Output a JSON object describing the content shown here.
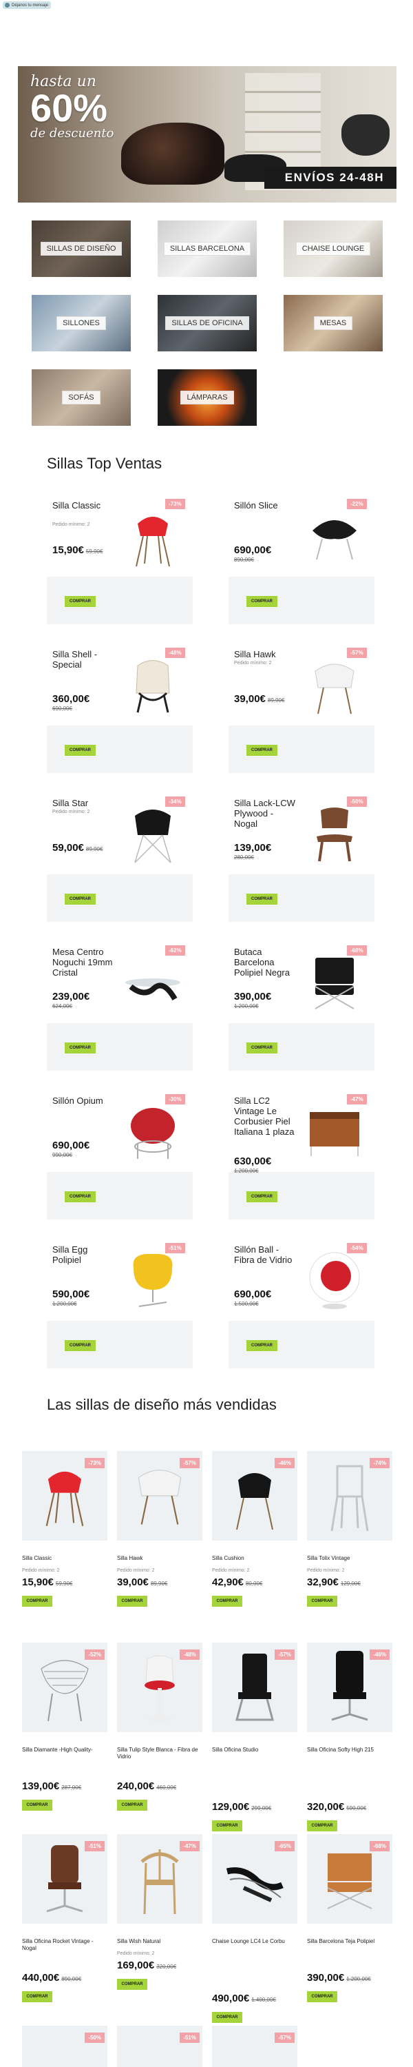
{
  "top_chip": {
    "text": "Déjanos tu mensaje"
  },
  "hero": {
    "line1": "hasta un",
    "line2": "60%",
    "line3": "de descuento",
    "shipping": "ENVÍOS 24-48H"
  },
  "categories": [
    {
      "label": "SILLAS DE DISEÑO"
    },
    {
      "label": "SILLAS BARCELONA"
    },
    {
      "label": "CHAISE LOUNGE"
    },
    {
      "label": "SILLONES"
    },
    {
      "label": "SILLAS DE OFICINA"
    },
    {
      "label": "MESAS"
    },
    {
      "label": "SOFÁS"
    },
    {
      "label": "LÁMPARAS"
    }
  ],
  "top_sales": {
    "title": "Sillas Top Ventas",
    "buy_label": "COMPRAR",
    "items": [
      {
        "name": "Silla Classic",
        "min": "Pedido mínimo: 2",
        "price": "15,90€",
        "old": "59,90€",
        "badge": "-73%"
      },
      {
        "name": "Sillón Slice",
        "min": "",
        "price": "690,00€",
        "old": "890,00€",
        "badge": "-22%"
      },
      {
        "name": "Silla Shell - Special",
        "min": "",
        "price": "360,00€",
        "old": "690,00€",
        "badge": "-48%"
      },
      {
        "name": "Silla Hawk",
        "min": "Pedido mínimo: 2",
        "price": "39,00€",
        "old": "89,90€",
        "badge": "-57%"
      },
      {
        "name": "Silla Star",
        "min": "Pedido mínimo: 2",
        "price": "59,00€",
        "old": "89,90€",
        "badge": "-34%"
      },
      {
        "name": "Silla Lack-LCW Plywood - Nogal",
        "min": "",
        "price": "139,00€",
        "old": "280,00€",
        "badge": "-50%"
      },
      {
        "name": "Mesa Centro Noguchi 19mm Cristal",
        "min": "",
        "price": "239,00€",
        "old": "624,00€",
        "badge": "-62%"
      },
      {
        "name": "Butaca Barcelona Polipiel Negra",
        "min": "",
        "price": "390,00€",
        "old": "1.200,00€",
        "badge": "-68%"
      },
      {
        "name": "Sillón Opium",
        "min": "",
        "price": "690,00€",
        "old": "990,00€",
        "badge": "-30%"
      },
      {
        "name": "Silla LC2 Vintage Le Corbusier Piel Italiana 1 plaza",
        "min": "",
        "price": "630,00€",
        "old": "1.200,00€",
        "badge": "-47%"
      },
      {
        "name": "Silla Egg Polipiel",
        "min": "",
        "price": "590,00€",
        "old": "1.200,00€",
        "badge": "-51%"
      },
      {
        "name": "Sillón Ball - Fibra de Vidrio",
        "min": "",
        "price": "690,00€",
        "old": "1.500,00€",
        "badge": "-54%"
      }
    ]
  },
  "best_sellers": {
    "title": "Las sillas de diseño más vendidas",
    "buy_label": "COMPRAR",
    "items": [
      {
        "name": "Silla Classic",
        "min": "Pedido mínimo: 2",
        "price": "15,90€",
        "old": "59,90€",
        "badge": "-73%"
      },
      {
        "name": "Silla Hawk",
        "min": "Pedido mínimo: 2",
        "price": "39,00€",
        "old": "89,90€",
        "badge": "-57%"
      },
      {
        "name": "Silla Cushion",
        "min": "Pedido mínimo: 2",
        "price": "42,90€",
        "old": "80,00€",
        "badge": "-46%"
      },
      {
        "name": "Silla Tolix Vintage",
        "min": "Pedido mínimo: 2",
        "price": "32,90€",
        "old": "129,00€",
        "badge": "-74%"
      },
      {
        "name": "Silla Diamante -High Quality-",
        "min": "",
        "price": "139,00€",
        "old": "287,00€",
        "badge": "-52%"
      },
      {
        "name": "Silla Tulip Style Blanca - Fibra de Vidrio",
        "min": "",
        "price": "240,00€",
        "old": "460,00€",
        "badge": "-48%"
      },
      {
        "name": "Silla Oficina Studio",
        "min": "",
        "price": "129,00€",
        "old": "299,00€",
        "badge": "-57%"
      },
      {
        "name": "Silla Oficina Softy High 215",
        "min": "",
        "price": "320,00€",
        "old": "590,00€",
        "badge": "-46%"
      },
      {
        "name": "Silla Oficina Rocket Vintage - Nogal",
        "min": "",
        "price": "440,00€",
        "old": "890,00€",
        "badge": "-51%"
      },
      {
        "name": "Silla Wish Natural",
        "min": "Pedido mínimo: 2",
        "price": "169,00€",
        "old": "320,00€",
        "badge": "-47%"
      },
      {
        "name": "Chaise Lounge LC4 Le Corbu",
        "min": "",
        "price": "490,00€",
        "old": "1.400,00€",
        "badge": "-65%"
      },
      {
        "name": "Silla Barcelona Teja Polipiel",
        "min": "",
        "price": "390,00€",
        "old": "1.200,00€",
        "badge": "-68%"
      }
    ],
    "partial_badges": [
      "-50%",
      "-51%",
      "-57%"
    ]
  },
  "colors": {
    "badge": "#f3a3a8",
    "buy": "#a4d33a",
    "card_bg": "#f1f3f5"
  }
}
